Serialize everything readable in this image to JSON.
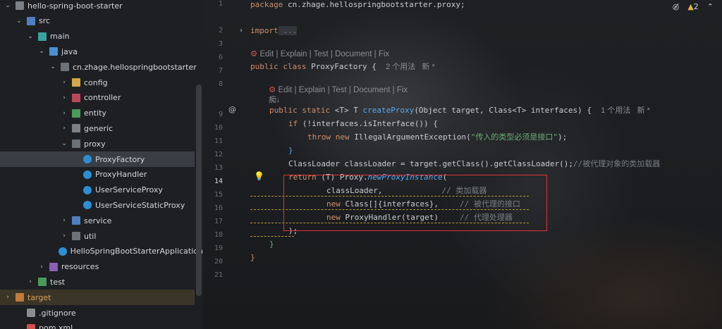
{
  "project_tree": {
    "items": [
      {
        "label": "hello-spring-boot-starter",
        "arrow": "down",
        "icon": "folder",
        "level": 0
      },
      {
        "label": "src",
        "arrow": "down",
        "icon": "source-folder",
        "level": 1
      },
      {
        "label": "main",
        "arrow": "down",
        "icon": "module-folder",
        "level": 2
      },
      {
        "label": "java",
        "arrow": "down",
        "icon": "java-folder",
        "level": 3
      },
      {
        "label": "cn.zhage.hellospringbootstarter",
        "arrow": "down",
        "icon": "package",
        "level": 4
      },
      {
        "label": "config",
        "arrow": "right",
        "icon": "config-package",
        "level": 5
      },
      {
        "label": "controller",
        "arrow": "right",
        "icon": "controller-package",
        "level": 5
      },
      {
        "label": "entity",
        "arrow": "right",
        "icon": "entity-package",
        "level": 5
      },
      {
        "label": "generic",
        "arrow": "right",
        "icon": "folder",
        "level": 5
      },
      {
        "label": "proxy",
        "arrow": "down",
        "icon": "package",
        "level": 5
      },
      {
        "label": "ProxyFactory",
        "arrow": "",
        "icon": "class",
        "level": 6
      },
      {
        "label": "ProxyHandler",
        "arrow": "",
        "icon": "class",
        "level": 6
      },
      {
        "label": "UserServiceProxy",
        "arrow": "",
        "icon": "class",
        "level": 6
      },
      {
        "label": "UserServiceStaticProxy",
        "arrow": "",
        "icon": "class",
        "level": 6
      },
      {
        "label": "service",
        "arrow": "right",
        "icon": "service-package",
        "level": 5
      },
      {
        "label": "util",
        "arrow": "right",
        "icon": "util-package",
        "level": 5
      },
      {
        "label": "HelloSpringBootStarterApplication",
        "arrow": "",
        "icon": "spring-class",
        "level": 5
      },
      {
        "label": "resources",
        "arrow": "right",
        "icon": "resources-folder",
        "level": 3
      },
      {
        "label": "test",
        "arrow": "right",
        "icon": "test-folder",
        "level": 2
      },
      {
        "label": "target",
        "arrow": "right",
        "icon": "excluded-folder",
        "level": 0
      },
      {
        "label": ".gitignore",
        "arrow": "",
        "icon": "gitignore-file",
        "level": 1
      },
      {
        "label": "pom.xml",
        "arrow": "",
        "icon": "maven-file",
        "level": 1
      }
    ],
    "selected": "ProxyFactory"
  },
  "editor": {
    "line_numbers": [
      "1",
      "2",
      "3",
      "6",
      "7",
      "8",
      "",
      "9",
      "10",
      "11",
      "12",
      "13",
      "14",
      "15",
      "16",
      "17",
      "18",
      "19",
      "20",
      "21"
    ],
    "current_line": "14",
    "warnings_count": "2",
    "lens_1": {
      "actions": "Edit | Explain | Test | Document | Fix"
    },
    "lens_2": {
      "actions": "Edit | Explain | Test | Document | Fix"
    },
    "code": {
      "package_kw": "package",
      "package_name": " cn.zhage.hellospringbootstarter.proxy;",
      "import_kw": "import",
      "import_fold": " ...",
      "class_decl_kw": "public class",
      "class_name": " ProxyFactory {",
      "class_hint": "2 个用法   新 *",
      "glyph": "痴↓",
      "method_kw": "public static",
      "method_sig_1": " <T> T ",
      "method_name": "createProxy",
      "method_sig_2": "(Object target, Class<T> interfaces) {",
      "method_hint": "1 个用法   新 *",
      "if_kw": "if",
      "if_rest": " (!interfaces.isInterface()) {",
      "throw_kw": "throw new",
      "throw_rest": " IllegalArgumentException(",
      "throw_str": "\"传入的类型必须是接口\"",
      "throw_end": ");",
      "close_brace": "}",
      "cl_line": "ClassLoader classLoader = target.getClass().getClassLoader();",
      "cl_comment": "//被代理对象的类加载器",
      "ret_kw": "return",
      "ret_rest": " (T) Proxy.",
      "ret_method": "newProxyInstance",
      "ret_paren": "(",
      "arg1": "classLoader,",
      "arg1_comment": "// 类加载器",
      "arg2_kw": "new",
      "arg2": " Class[]{interfaces},",
      "arg2_comment": "// 被代理的接口",
      "arg3_kw": "new",
      "arg3": " ProxyHandler(target)",
      "arg3_comment": "// 代理处理器",
      "ret_close": ");",
      "method_close": "}",
      "class_close": "}"
    }
  }
}
